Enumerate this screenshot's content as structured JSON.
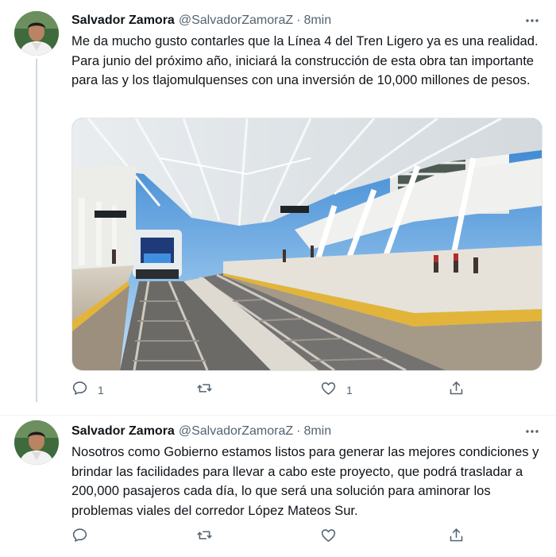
{
  "tweets": [
    {
      "name": "Salvador Zamora",
      "handle": "@SalvadorZamoraZ",
      "separator": "·",
      "time": "8min",
      "text": "Me da mucho gusto contarles que la Línea 4 del Tren Ligero ya es una realidad. Para junio del próximo año, iniciará la construcción de esta obra tan importante para las y los tlajomulquenses con una inversión de 10,000 millones de pesos.",
      "reply_count": "1",
      "retweet_count": "",
      "like_count": "1"
    },
    {
      "name": "Salvador Zamora",
      "handle": "@SalvadorZamoraZ",
      "separator": "·",
      "time": "8min",
      "text": "Nosotros como Gobierno estamos listos para generar las mejores condiciones y brindar las facilidades para llevar a cabo este proyecto, que podrá trasladar a 200,000 pasajeros cada día, lo que será una solución para aminorar los problemas viales del corredor López Mateos Sur.",
      "reply_count": "",
      "retweet_count": "",
      "like_count": ""
    }
  ],
  "colors": {
    "text": "#0f1419",
    "secondary": "#536471",
    "thread_line": "#cfd9de"
  },
  "icons": [
    "more-icon",
    "reply-icon",
    "retweet-icon",
    "like-icon",
    "share-icon"
  ]
}
